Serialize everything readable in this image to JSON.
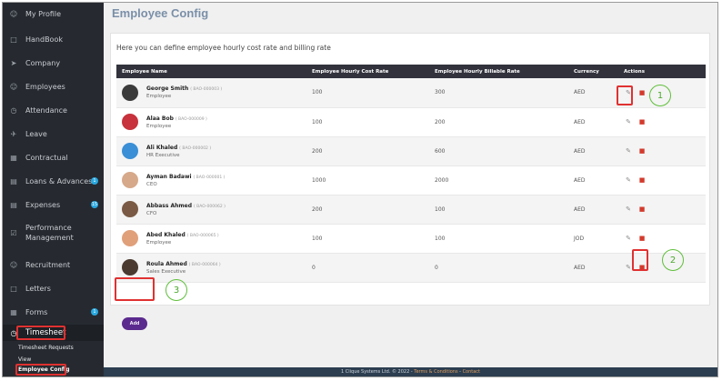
{
  "sidebar": {
    "items": [
      {
        "label": "My Profile",
        "icon": "user-icon"
      },
      {
        "label": "HandBook",
        "icon": "book-icon"
      },
      {
        "label": "Company",
        "icon": "rocket-icon"
      },
      {
        "label": "Employees",
        "icon": "users-icon"
      },
      {
        "label": "Attendance",
        "icon": "clock-icon"
      },
      {
        "label": "Leave",
        "icon": "plane-icon"
      },
      {
        "label": "Contractual",
        "icon": "grid-icon"
      },
      {
        "label": "Loans & Advances",
        "icon": "wallet-icon",
        "badge": "1"
      },
      {
        "label": "Expenses",
        "icon": "receipt-icon",
        "badge": "15"
      },
      {
        "label": "Performance Management",
        "icon": "check-box-icon"
      },
      {
        "label": "Recruitment",
        "icon": "user-icon"
      },
      {
        "label": "Letters",
        "icon": "file-icon"
      },
      {
        "label": "Forms",
        "icon": "forms-icon",
        "badge": "1"
      },
      {
        "label": "Timesheet",
        "icon": "clock-icon"
      }
    ],
    "sub_items": [
      "Timesheet Requests",
      "View",
      "Employee Config"
    ]
  },
  "main": {
    "title": "Employee Config",
    "description": "Here you can define employee hourly cost rate and billing rate",
    "add_label": "Add"
  },
  "table": {
    "headers": [
      "Employee Name",
      "Employee Hourly Cost Rate",
      "Employee Hourly Billable Rate",
      "Currency",
      "Actions"
    ],
    "rows": [
      {
        "name": "George Smith",
        "code": "( BAO-000003 )",
        "role": "Employee",
        "cost": "100",
        "bill": "300",
        "currency": "AED",
        "avatar_color": "#3b3b3b"
      },
      {
        "name": "Alaa Bob",
        "code": "( BAO-000009 )",
        "role": "Employee",
        "cost": "100",
        "bill": "200",
        "currency": "AED",
        "avatar_color": "#c7323c"
      },
      {
        "name": "Ali Khaled",
        "code": "( BAO-000002 )",
        "role": "HR Executive",
        "cost": "200",
        "bill": "600",
        "currency": "AED",
        "avatar_color": "#3a8fd6"
      },
      {
        "name": "Ayman Badawi",
        "code": "( BAO-000001 )",
        "role": "CEO",
        "cost": "1000",
        "bill": "2000",
        "currency": "AED",
        "avatar_color": "#d6a98a"
      },
      {
        "name": "Abbass Ahmed",
        "code": "( BAO-000062 )",
        "role": "CFO",
        "cost": "200",
        "bill": "100",
        "currency": "AED",
        "avatar_color": "#7a5a45"
      },
      {
        "name": "Abed Khaled",
        "code": "( BAO-000065 )",
        "role": "Employee",
        "cost": "100",
        "bill": "100",
        "currency": "JOD",
        "avatar_color": "#e0a07a"
      },
      {
        "name": "Roula Ahmed",
        "code": "( BAO-000064 )",
        "role": "Sales Executive",
        "cost": "0",
        "bill": "0",
        "currency": "AED",
        "avatar_color": "#4a3a30"
      }
    ]
  },
  "annotations": [
    "1",
    "2",
    "3"
  ],
  "footer": {
    "text": "1 Clique Systems Ltd. © 2022 -",
    "terms": "Terms & Conditions",
    "sep": "-",
    "contact": "Contact"
  },
  "colors": {
    "sidebar_bg": "#262a30",
    "table_header": "#31323c",
    "add_button": "#5b2a8e",
    "delete": "#d33a2c",
    "annotation_red": "#e03131",
    "annotation_green": "#5fbf3a"
  }
}
